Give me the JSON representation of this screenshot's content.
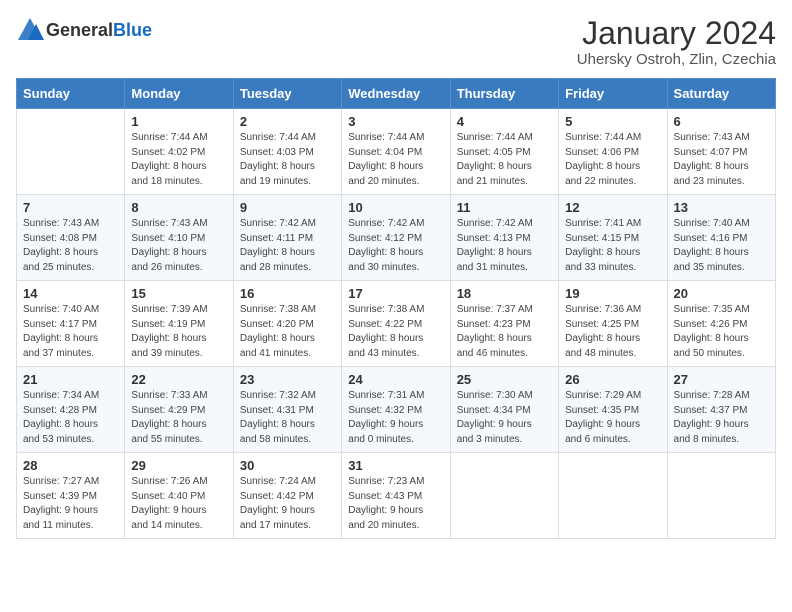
{
  "header": {
    "logo_general": "General",
    "logo_blue": "Blue",
    "title": "January 2024",
    "location": "Uhersky Ostroh, Zlin, Czechia"
  },
  "days_of_week": [
    "Sunday",
    "Monday",
    "Tuesday",
    "Wednesday",
    "Thursday",
    "Friday",
    "Saturday"
  ],
  "weeks": [
    [
      {
        "day": "",
        "info": ""
      },
      {
        "day": "1",
        "info": "Sunrise: 7:44 AM\nSunset: 4:02 PM\nDaylight: 8 hours\nand 18 minutes."
      },
      {
        "day": "2",
        "info": "Sunrise: 7:44 AM\nSunset: 4:03 PM\nDaylight: 8 hours\nand 19 minutes."
      },
      {
        "day": "3",
        "info": "Sunrise: 7:44 AM\nSunset: 4:04 PM\nDaylight: 8 hours\nand 20 minutes."
      },
      {
        "day": "4",
        "info": "Sunrise: 7:44 AM\nSunset: 4:05 PM\nDaylight: 8 hours\nand 21 minutes."
      },
      {
        "day": "5",
        "info": "Sunrise: 7:44 AM\nSunset: 4:06 PM\nDaylight: 8 hours\nand 22 minutes."
      },
      {
        "day": "6",
        "info": "Sunrise: 7:43 AM\nSunset: 4:07 PM\nDaylight: 8 hours\nand 23 minutes."
      }
    ],
    [
      {
        "day": "7",
        "info": "Sunrise: 7:43 AM\nSunset: 4:08 PM\nDaylight: 8 hours\nand 25 minutes."
      },
      {
        "day": "8",
        "info": "Sunrise: 7:43 AM\nSunset: 4:10 PM\nDaylight: 8 hours\nand 26 minutes."
      },
      {
        "day": "9",
        "info": "Sunrise: 7:42 AM\nSunset: 4:11 PM\nDaylight: 8 hours\nand 28 minutes."
      },
      {
        "day": "10",
        "info": "Sunrise: 7:42 AM\nSunset: 4:12 PM\nDaylight: 8 hours\nand 30 minutes."
      },
      {
        "day": "11",
        "info": "Sunrise: 7:42 AM\nSunset: 4:13 PM\nDaylight: 8 hours\nand 31 minutes."
      },
      {
        "day": "12",
        "info": "Sunrise: 7:41 AM\nSunset: 4:15 PM\nDaylight: 8 hours\nand 33 minutes."
      },
      {
        "day": "13",
        "info": "Sunrise: 7:40 AM\nSunset: 4:16 PM\nDaylight: 8 hours\nand 35 minutes."
      }
    ],
    [
      {
        "day": "14",
        "info": "Sunrise: 7:40 AM\nSunset: 4:17 PM\nDaylight: 8 hours\nand 37 minutes."
      },
      {
        "day": "15",
        "info": "Sunrise: 7:39 AM\nSunset: 4:19 PM\nDaylight: 8 hours\nand 39 minutes."
      },
      {
        "day": "16",
        "info": "Sunrise: 7:38 AM\nSunset: 4:20 PM\nDaylight: 8 hours\nand 41 minutes."
      },
      {
        "day": "17",
        "info": "Sunrise: 7:38 AM\nSunset: 4:22 PM\nDaylight: 8 hours\nand 43 minutes."
      },
      {
        "day": "18",
        "info": "Sunrise: 7:37 AM\nSunset: 4:23 PM\nDaylight: 8 hours\nand 46 minutes."
      },
      {
        "day": "19",
        "info": "Sunrise: 7:36 AM\nSunset: 4:25 PM\nDaylight: 8 hours\nand 48 minutes."
      },
      {
        "day": "20",
        "info": "Sunrise: 7:35 AM\nSunset: 4:26 PM\nDaylight: 8 hours\nand 50 minutes."
      }
    ],
    [
      {
        "day": "21",
        "info": "Sunrise: 7:34 AM\nSunset: 4:28 PM\nDaylight: 8 hours\nand 53 minutes."
      },
      {
        "day": "22",
        "info": "Sunrise: 7:33 AM\nSunset: 4:29 PM\nDaylight: 8 hours\nand 55 minutes."
      },
      {
        "day": "23",
        "info": "Sunrise: 7:32 AM\nSunset: 4:31 PM\nDaylight: 8 hours\nand 58 minutes."
      },
      {
        "day": "24",
        "info": "Sunrise: 7:31 AM\nSunset: 4:32 PM\nDaylight: 9 hours\nand 0 minutes."
      },
      {
        "day": "25",
        "info": "Sunrise: 7:30 AM\nSunset: 4:34 PM\nDaylight: 9 hours\nand 3 minutes."
      },
      {
        "day": "26",
        "info": "Sunrise: 7:29 AM\nSunset: 4:35 PM\nDaylight: 9 hours\nand 6 minutes."
      },
      {
        "day": "27",
        "info": "Sunrise: 7:28 AM\nSunset: 4:37 PM\nDaylight: 9 hours\nand 8 minutes."
      }
    ],
    [
      {
        "day": "28",
        "info": "Sunrise: 7:27 AM\nSunset: 4:39 PM\nDaylight: 9 hours\nand 11 minutes."
      },
      {
        "day": "29",
        "info": "Sunrise: 7:26 AM\nSunset: 4:40 PM\nDaylight: 9 hours\nand 14 minutes."
      },
      {
        "day": "30",
        "info": "Sunrise: 7:24 AM\nSunset: 4:42 PM\nDaylight: 9 hours\nand 17 minutes."
      },
      {
        "day": "31",
        "info": "Sunrise: 7:23 AM\nSunset: 4:43 PM\nDaylight: 9 hours\nand 20 minutes."
      },
      {
        "day": "",
        "info": ""
      },
      {
        "day": "",
        "info": ""
      },
      {
        "day": "",
        "info": ""
      }
    ]
  ]
}
